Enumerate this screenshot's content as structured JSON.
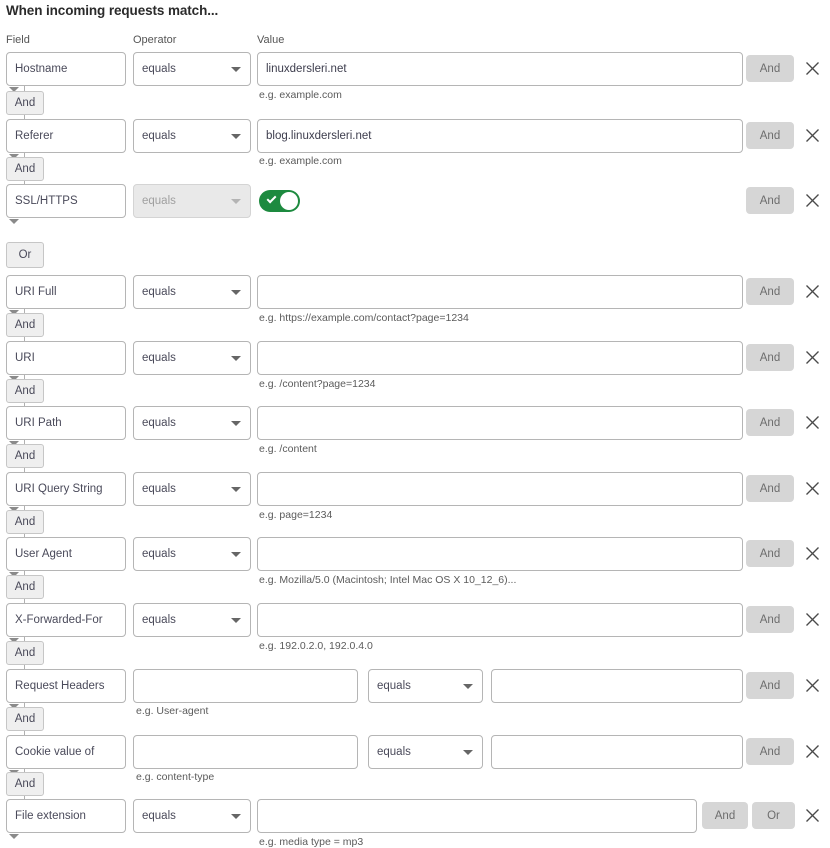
{
  "page_title": "When incoming requests match...",
  "columns": {
    "field": "Field",
    "operator": "Operator",
    "value": "Value"
  },
  "labels": {
    "and": "And",
    "or": "Or",
    "close_icon": "close-icon",
    "toggle_on": "on"
  },
  "colors": {
    "toggle_on": "#1d8a3f",
    "button_bg": "#d6d6d6",
    "chip_bg": "#efefef",
    "border": "#b5b5b5"
  },
  "rows": [
    {
      "field": "Hostname",
      "operator": "equals",
      "value": "linuxdersleri.net",
      "hint": "e.g. example.com",
      "connector": "And",
      "right_buttons": [
        "And"
      ],
      "type": "simple"
    },
    {
      "field": "Referer",
      "operator": "equals",
      "value": "blog.linuxdersleri.net",
      "hint": "e.g. example.com",
      "connector": "And",
      "right_buttons": [
        "And"
      ],
      "type": "simple"
    },
    {
      "field": "SSL/HTTPS",
      "operator": "equals",
      "value": "",
      "hint": "",
      "connector": "Or",
      "right_buttons": [
        "And"
      ],
      "type": "toggle"
    },
    {
      "field": "URI Full",
      "operator": "equals",
      "value": "",
      "hint": "e.g. https://example.com/contact?page=1234",
      "connector": "And",
      "right_buttons": [
        "And"
      ],
      "type": "simple"
    },
    {
      "field": "URI",
      "operator": "equals",
      "value": "",
      "hint": "e.g. /content?page=1234",
      "connector": "And",
      "right_buttons": [
        "And"
      ],
      "type": "simple"
    },
    {
      "field": "URI Path",
      "operator": "equals",
      "value": "",
      "hint": "e.g. /content",
      "connector": "And",
      "right_buttons": [
        "And"
      ],
      "type": "simple"
    },
    {
      "field": "URI Query String",
      "operator": "equals",
      "value": "",
      "hint": "e.g. page=1234",
      "connector": "And",
      "right_buttons": [
        "And"
      ],
      "type": "simple"
    },
    {
      "field": "User Agent",
      "operator": "equals",
      "value": "",
      "hint": "e.g. Mozilla/5.0 (Macintosh; Intel Mac OS X 10_12_6)...",
      "connector": "And",
      "right_buttons": [
        "And"
      ],
      "type": "simple"
    },
    {
      "field": "X-Forwarded-For",
      "operator": "equals",
      "value": "",
      "hint": "e.g. 192.0.2.0, 192.0.4.0",
      "connector": "And",
      "right_buttons": [
        "And"
      ],
      "type": "simple"
    },
    {
      "field": "Request Headers",
      "key": "",
      "operator": "equals",
      "value": "",
      "hint": "e.g. User-agent",
      "connector": "And",
      "right_buttons": [
        "And"
      ],
      "type": "keyvalue"
    },
    {
      "field": "Cookie value of",
      "key": "",
      "operator": "equals",
      "value": "",
      "hint": "e.g. content-type",
      "connector": "And",
      "right_buttons": [
        "And"
      ],
      "type": "keyvalue"
    },
    {
      "field": "File extension",
      "operator": "equals",
      "value": "",
      "hint": "e.g. media type = mp3",
      "connector": "",
      "right_buttons": [
        "And",
        "Or"
      ],
      "type": "last"
    }
  ]
}
